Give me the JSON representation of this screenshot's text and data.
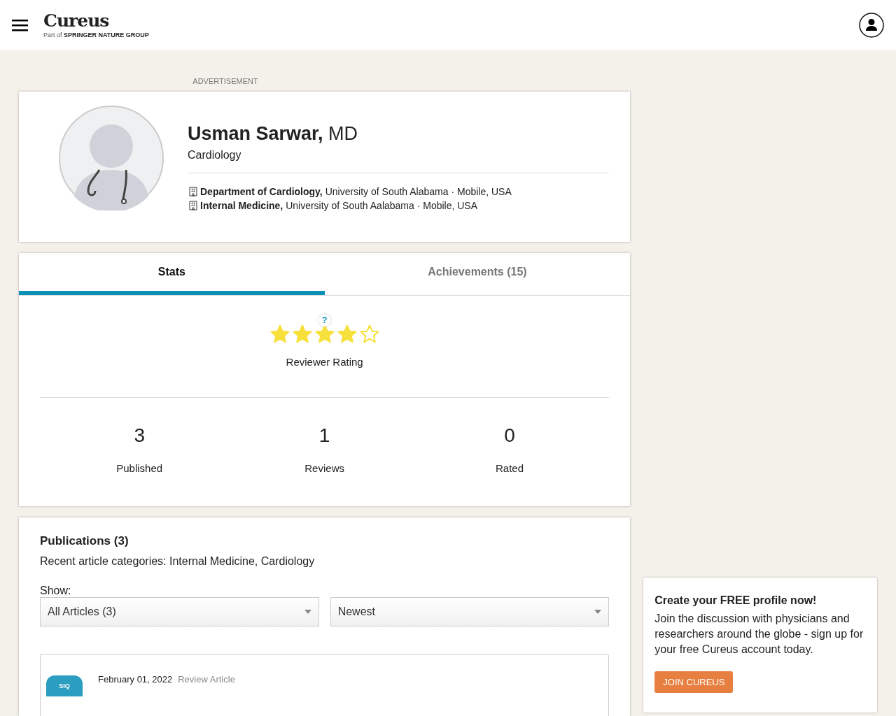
{
  "header": {
    "logo": "Cureus",
    "tagline_prefix": "Part of",
    "tagline_brand": "SPRINGER NATURE GROUP"
  },
  "advertisement_label": "ADVERTISEMENT",
  "profile": {
    "name": "**Usman Sarwar,** MD",
    "specialty": "Cardiology",
    "affiliations": [
      "**Department of Cardiology,** University of South Alabama · Mobile, USA",
      "**Internal Medicine,** University of South Aalabama · Mobile, USA"
    ]
  },
  "tabs": [
    {
      "label": "Stats",
      "selected": true
    },
    {
      "label": "Achievements (15)",
      "selected": false
    }
  ],
  "rating": {
    "stars": 4,
    "help_mark": "?",
    "label": "Reviewer Rating"
  },
  "stats": [
    {
      "value": "3",
      "label": "Published"
    },
    {
      "value": "1",
      "label": "Reviews"
    },
    {
      "value": "0",
      "label": "Rated"
    }
  ],
  "publications": {
    "title": "Publications (3)",
    "categories": "Recent article categories: Internal Medicine, Cardiology",
    "show_label": "Show:",
    "filters": [
      "All Articles (3)",
      "Newest"
    ],
    "articles": [
      {
        "badge": "SIQ",
        "date": "February 01, 2022",
        "type": "Review Article"
      }
    ]
  },
  "signup": {
    "title": "Create your FREE profile now!",
    "text": "Join the discussion with physicians and researchers around the globe - sign up for your free Cureus account today.",
    "button": "JOIN CUREUS"
  }
}
